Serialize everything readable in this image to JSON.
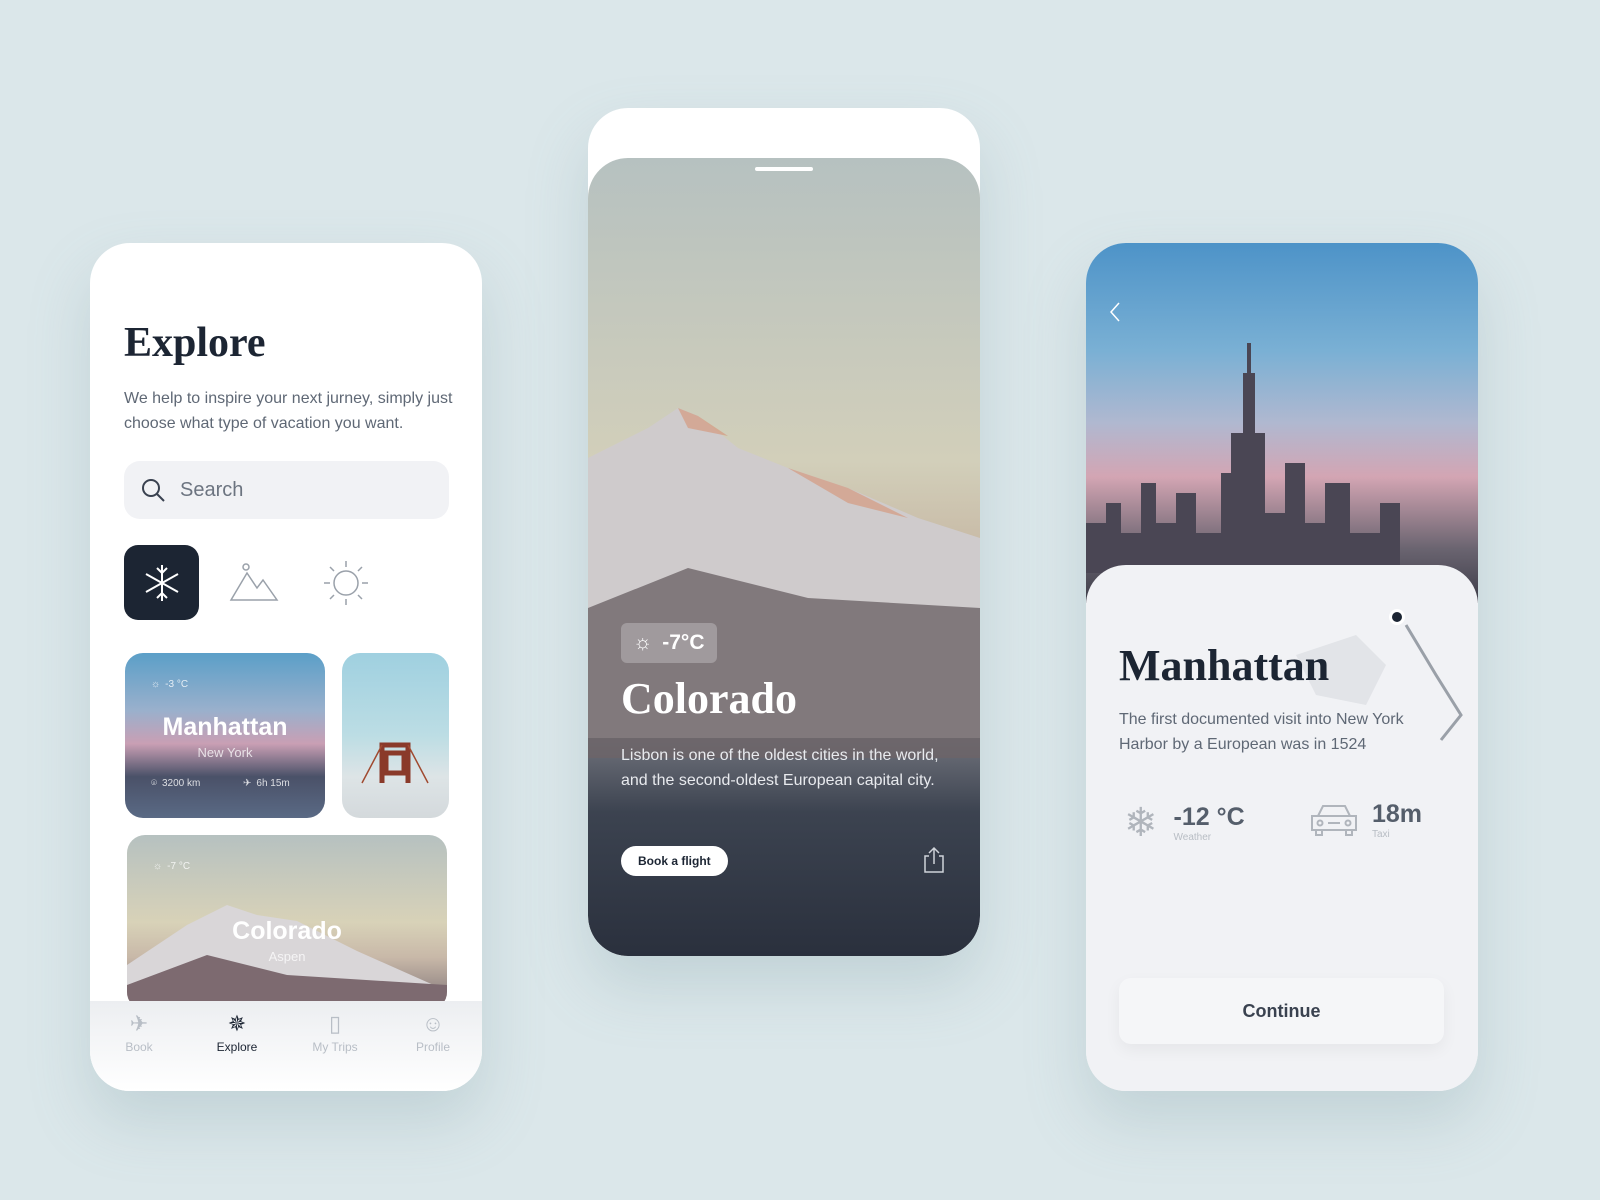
{
  "explore": {
    "title": "Explore",
    "subtitle": "We help to inspire your next jurney, simply just choose what type of vacation you want.",
    "search_placeholder": "Search",
    "categories": [
      {
        "icon": "snowflake-icon",
        "active": true
      },
      {
        "icon": "mountain-icon",
        "active": false
      },
      {
        "icon": "sun-icon",
        "active": false
      }
    ],
    "cards": [
      {
        "temp": "-3 °C",
        "title": "Manhattan",
        "subtitle": "New York",
        "distance": "3200 km",
        "flight_time": "6h 15m"
      },
      {
        "title": "",
        "subtitle": ""
      },
      {
        "temp": "-7 °C",
        "title": "Colorado",
        "subtitle": "Aspen"
      }
    ],
    "nav": [
      {
        "label": "Book",
        "icon": "plane-icon"
      },
      {
        "label": "Explore",
        "icon": "compass-star-icon",
        "active": true
      },
      {
        "label": "My Trips",
        "icon": "luggage-icon"
      },
      {
        "label": "Profile",
        "icon": "user-icon"
      }
    ]
  },
  "detail": {
    "temp": "-7°C",
    "title": "Colorado",
    "description": "Lisbon is one of the oldest cities in the world, and the second-oldest European capital city.",
    "book_label": "Book a flight"
  },
  "manhattan": {
    "title": "Manhattan",
    "description": "The first documented visit into New York Harbor by a European was in 1524",
    "weather_value": "-12 °C",
    "weather_label": "Weather",
    "taxi_value": "18m",
    "taxi_label": "Taxi",
    "continue_label": "Continue"
  },
  "colors": {
    "dark": "#1c2533",
    "accent_bg": "#dbe7ea"
  }
}
